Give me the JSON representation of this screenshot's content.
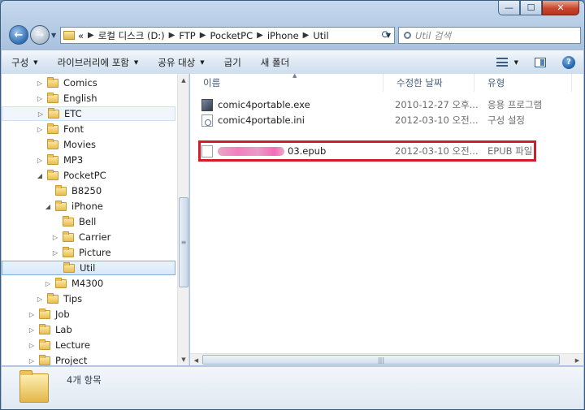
{
  "window": {
    "buttons": {
      "minimize": "—",
      "maximize": "☐",
      "close": "✕"
    }
  },
  "address": {
    "prefix": "«",
    "crumbs": [
      "로컬 디스크 (D:)",
      "FTP",
      "PocketPC",
      "iPhone",
      "Util"
    ],
    "search_placeholder": "Util 검색"
  },
  "toolbar": {
    "organize": "구성",
    "library": "라이브러리에 포함",
    "share": "공유 대상",
    "burn": "굽기",
    "new_folder": "새 폴더"
  },
  "tree": [
    {
      "label": "Comics",
      "expander": "▷"
    },
    {
      "label": "English",
      "expander": "▷"
    },
    {
      "label": "ETC",
      "expander": "▷"
    },
    {
      "label": "Font",
      "expander": "▷"
    },
    {
      "label": "Movies",
      "expander": ""
    },
    {
      "label": "MP3",
      "expander": "▷"
    },
    {
      "label": "PocketPC",
      "expander": "◢"
    },
    {
      "label": "B8250",
      "expander": ""
    },
    {
      "label": "iPhone",
      "expander": "◢"
    },
    {
      "label": "Bell",
      "expander": ""
    },
    {
      "label": "Carrier",
      "expander": "▷"
    },
    {
      "label": "Picture",
      "expander": "▷"
    },
    {
      "label": "Util",
      "expander": ""
    },
    {
      "label": "M4300",
      "expander": "▷"
    },
    {
      "label": "Tips",
      "expander": "▷"
    },
    {
      "label": "Job",
      "expander": "▷"
    },
    {
      "label": "Lab",
      "expander": "▷"
    },
    {
      "label": "Lecture",
      "expander": "▷"
    },
    {
      "label": "Project",
      "expander": "▷"
    }
  ],
  "columns": {
    "name": "이름",
    "modified": "수정한 날짜",
    "type": "유형"
  },
  "files": [
    {
      "name": "comic4portable.exe",
      "modified": "2010-12-27 오후...",
      "type": "응용 프로그램",
      "icon": "exe-icon"
    },
    {
      "name": "comic4portable.ini",
      "modified": "2012-03-10 오전...",
      "type": "구성 설정",
      "icon": "settings-file-icon"
    },
    {
      "name": "03.epub",
      "modified": "2012-03-10 오전...",
      "type": "EPUB 파일",
      "icon": "document-icon"
    }
  ],
  "status": {
    "item_count": "4개 항목"
  },
  "colors": {
    "highlight_box": "#d21e2c",
    "selection": "#d7e8f8"
  }
}
